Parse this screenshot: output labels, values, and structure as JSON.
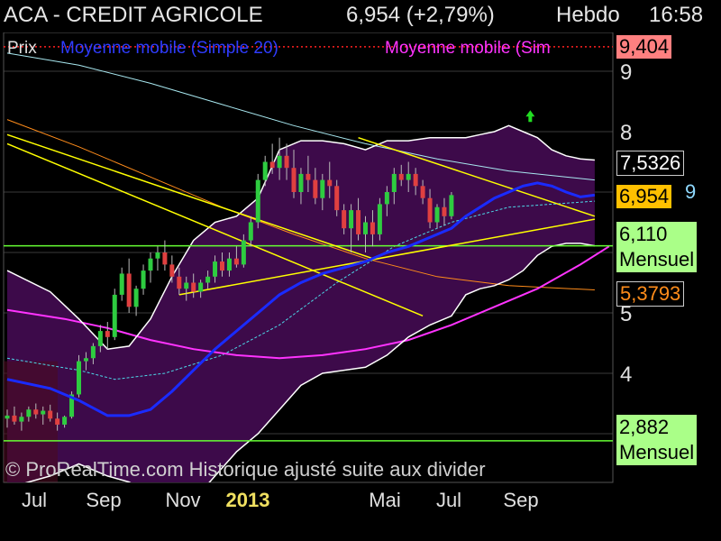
{
  "header": {
    "title": "ACA - CREDIT AGRICOLE",
    "price_change": "6,954 (+2,79%)",
    "period": "Hebdo",
    "time": "16:58"
  },
  "legend": {
    "prix": "Prix",
    "mm20": "Moyenne mobile (Simple 20)",
    "mm2": "Moyenne mobile (Sim"
  },
  "price_boxes": {
    "high": "9,404",
    "upper": "7,5326",
    "current": "6,954",
    "current_tail": "9",
    "support1": "6,110",
    "support1_label": "Mensuel",
    "lower": "5,3793",
    "support2": "2,882",
    "support2_label": "Mensuel"
  },
  "copyright": "© ProRealTime.com Historique ajusté suite aux divider",
  "colors": {
    "background": "#000000",
    "up_candle": "#2ecc40",
    "down_candle": "#e04040",
    "mm20": "#1a2bff",
    "mm_long": "#ff33ff",
    "bollinger_fill": "#3d0a4a",
    "trendline": "#ffff00",
    "support_line": "#66ff33",
    "resistance_dotted": "#ff2020",
    "grid": "#3a3a3a"
  },
  "chart_data": {
    "type": "candlestick",
    "title": "ACA - CREDIT AGRICOLE",
    "period": "Hebdo",
    "yticks": [
      4,
      5,
      8,
      9
    ],
    "xticks": [
      "Jul",
      "Sep",
      "Nov",
      "2013",
      "Mai",
      "Jul",
      "Sep"
    ],
    "ylim": [
      2.5,
      9.6
    ],
    "horizontal_lines": [
      {
        "value": 9.404,
        "style": "dotted",
        "color": "#ff2020"
      },
      {
        "value": 6.11,
        "label": "Mensuel",
        "color": "#66ff33"
      },
      {
        "value": 2.882,
        "label": "Mensuel",
        "color": "#66ff33"
      }
    ],
    "last_price": 6.954,
    "series": [
      {
        "name": "Prix",
        "kind": "candles",
        "ohlc": [
          [
            3.25,
            3.4,
            3.1,
            3.3
          ],
          [
            3.3,
            3.45,
            3.15,
            3.2
          ],
          [
            3.2,
            3.35,
            3.05,
            3.28
          ],
          [
            3.28,
            3.45,
            3.2,
            3.4
          ],
          [
            3.4,
            3.5,
            3.25,
            3.32
          ],
          [
            3.32,
            3.45,
            3.15,
            3.38
          ],
          [
            3.38,
            3.48,
            3.2,
            3.25
          ],
          [
            3.25,
            3.35,
            3.05,
            3.15
          ],
          [
            3.15,
            3.3,
            3.1,
            3.28
          ],
          [
            3.28,
            3.7,
            3.25,
            3.65
          ],
          [
            3.65,
            4.3,
            3.6,
            4.2
          ],
          [
            4.2,
            4.35,
            4.05,
            4.25
          ],
          [
            4.25,
            4.5,
            4.15,
            4.45
          ],
          [
            4.45,
            4.8,
            4.35,
            4.7
          ],
          [
            4.7,
            4.85,
            4.4,
            4.6
          ],
          [
            4.6,
            5.4,
            4.55,
            5.3
          ],
          [
            5.3,
            5.75,
            5.2,
            5.65
          ],
          [
            5.65,
            5.9,
            5.0,
            5.1
          ],
          [
            5.1,
            5.45,
            4.95,
            5.4
          ],
          [
            5.4,
            5.8,
            5.3,
            5.7
          ],
          [
            5.7,
            6.0,
            5.5,
            5.9
          ],
          [
            5.9,
            6.1,
            5.7,
            6.0
          ],
          [
            6.0,
            6.2,
            5.7,
            5.8
          ],
          [
            5.8,
            5.95,
            5.5,
            5.6
          ],
          [
            5.6,
            5.75,
            5.3,
            5.4
          ],
          [
            5.4,
            5.6,
            5.2,
            5.5
          ],
          [
            5.5,
            5.65,
            5.25,
            5.35
          ],
          [
            5.35,
            5.55,
            5.25,
            5.5
          ],
          [
            5.5,
            5.7,
            5.4,
            5.6
          ],
          [
            5.6,
            5.95,
            5.5,
            5.85
          ],
          [
            5.85,
            6.0,
            5.6,
            5.7
          ],
          [
            5.7,
            6.0,
            5.6,
            5.9
          ],
          [
            5.9,
            6.1,
            5.75,
            5.8
          ],
          [
            5.8,
            6.3,
            5.75,
            6.2
          ],
          [
            6.2,
            6.6,
            6.1,
            6.5
          ],
          [
            6.5,
            7.3,
            6.4,
            7.2
          ],
          [
            7.2,
            7.6,
            7.1,
            7.5
          ],
          [
            7.5,
            7.8,
            7.3,
            7.4
          ],
          [
            7.4,
            7.9,
            7.2,
            7.6
          ],
          [
            7.6,
            7.8,
            7.2,
            7.4
          ],
          [
            7.4,
            7.7,
            6.9,
            7.0
          ],
          [
            7.0,
            7.4,
            6.8,
            7.3
          ],
          [
            7.3,
            7.6,
            7.0,
            7.2
          ],
          [
            7.2,
            7.4,
            6.8,
            6.9
          ],
          [
            6.9,
            7.3,
            6.7,
            7.2
          ],
          [
            7.2,
            7.5,
            6.9,
            7.1
          ],
          [
            7.1,
            7.2,
            6.6,
            6.7
          ],
          [
            6.7,
            6.8,
            6.3,
            6.4
          ],
          [
            6.4,
            6.8,
            6.0,
            6.7
          ],
          [
            6.7,
            6.9,
            6.2,
            6.3
          ],
          [
            6.3,
            6.6,
            6.0,
            6.5
          ],
          [
            6.5,
            6.7,
            6.1,
            6.3
          ],
          [
            6.3,
            6.9,
            6.2,
            6.8
          ],
          [
            6.8,
            7.1,
            6.6,
            7.0
          ],
          [
            7.0,
            7.4,
            6.8,
            7.3
          ],
          [
            7.3,
            7.45,
            7.1,
            7.2
          ],
          [
            7.2,
            7.5,
            7.0,
            7.3
          ],
          [
            7.3,
            7.4,
            6.95,
            7.1
          ],
          [
            7.1,
            7.2,
            6.8,
            6.9
          ],
          [
            6.9,
            7.05,
            6.4,
            6.5
          ],
          [
            6.5,
            6.8,
            6.4,
            6.75
          ],
          [
            6.75,
            6.9,
            6.45,
            6.6
          ],
          [
            6.6,
            7.0,
            6.55,
            6.95
          ]
        ]
      },
      {
        "name": "Moyenne mobile (Simple 20)",
        "kind": "line",
        "points": [
          [
            0,
            3.9
          ],
          [
            6,
            3.75
          ],
          [
            10,
            3.55
          ],
          [
            14,
            3.3
          ],
          [
            17,
            3.3
          ],
          [
            20,
            3.4
          ],
          [
            23,
            3.7
          ],
          [
            26,
            4.05
          ],
          [
            29,
            4.4
          ],
          [
            32,
            4.7
          ],
          [
            35,
            5.0
          ],
          [
            38,
            5.3
          ],
          [
            41,
            5.5
          ],
          [
            44,
            5.65
          ],
          [
            47,
            5.75
          ],
          [
            50,
            5.85
          ],
          [
            53,
            6.0
          ],
          [
            56,
            6.1
          ],
          [
            59,
            6.25
          ],
          [
            62,
            6.4
          ],
          [
            64,
            6.6
          ],
          [
            66,
            6.75
          ],
          [
            68,
            6.9
          ],
          [
            70,
            7.0
          ],
          [
            72,
            7.1
          ],
          [
            74,
            7.15
          ],
          [
            76,
            7.1
          ],
          [
            78,
            7.0
          ],
          [
            80,
            6.92
          ],
          [
            82,
            6.95
          ]
        ]
      },
      {
        "name": "Moyenne mobile (Sim",
        "kind": "line",
        "points": [
          [
            0,
            5.05
          ],
          [
            8,
            4.9
          ],
          [
            14,
            4.75
          ],
          [
            20,
            4.55
          ],
          [
            26,
            4.4
          ],
          [
            32,
            4.3
          ],
          [
            38,
            4.25
          ],
          [
            44,
            4.3
          ],
          [
            50,
            4.4
          ],
          [
            56,
            4.55
          ],
          [
            62,
            4.8
          ],
          [
            68,
            5.1
          ],
          [
            74,
            5.4
          ],
          [
            80,
            5.8
          ],
          [
            84,
            6.1
          ]
        ]
      },
      {
        "name": "MM long (cyan)",
        "kind": "line",
        "points": [
          [
            0,
            9.3
          ],
          [
            10,
            9.1
          ],
          [
            20,
            8.8
          ],
          [
            30,
            8.45
          ],
          [
            40,
            8.1
          ],
          [
            50,
            7.8
          ],
          [
            60,
            7.55
          ],
          [
            70,
            7.35
          ],
          [
            82,
            7.2
          ]
        ]
      },
      {
        "name": "MM long (orange)",
        "kind": "line",
        "points": [
          [
            0,
            8.2
          ],
          [
            10,
            7.75
          ],
          [
            20,
            7.25
          ],
          [
            30,
            6.75
          ],
          [
            40,
            6.3
          ],
          [
            50,
            5.9
          ],
          [
            60,
            5.6
          ],
          [
            70,
            5.45
          ],
          [
            82,
            5.38
          ]
        ]
      },
      {
        "name": "MM (cyan pointillé)",
        "kind": "line",
        "points": [
          [
            0,
            4.25
          ],
          [
            10,
            4.05
          ],
          [
            15,
            3.9
          ],
          [
            22,
            4.0
          ],
          [
            30,
            4.3
          ],
          [
            38,
            4.8
          ],
          [
            46,
            5.5
          ],
          [
            54,
            6.1
          ],
          [
            62,
            6.5
          ],
          [
            70,
            6.75
          ],
          [
            82,
            6.85
          ]
        ]
      },
      {
        "name": "Bollinger haute",
        "kind": "line",
        "points": [
          [
            0,
            5.7
          ],
          [
            6,
            5.35
          ],
          [
            10,
            4.9
          ],
          [
            14,
            4.4
          ],
          [
            17,
            4.45
          ],
          [
            20,
            4.9
          ],
          [
            23,
            5.6
          ],
          [
            26,
            6.2
          ],
          [
            29,
            6.5
          ],
          [
            32,
            6.6
          ],
          [
            35,
            6.9
          ],
          [
            38,
            7.7
          ],
          [
            41,
            7.85
          ],
          [
            44,
            7.85
          ],
          [
            47,
            7.8
          ],
          [
            50,
            7.7
          ],
          [
            53,
            7.85
          ],
          [
            56,
            7.85
          ],
          [
            59,
            7.9
          ],
          [
            62,
            7.9
          ],
          [
            64,
            7.9
          ],
          [
            66,
            7.95
          ],
          [
            68,
            8.0
          ],
          [
            70,
            8.1
          ],
          [
            72,
            8.0
          ],
          [
            74,
            7.9
          ],
          [
            76,
            7.7
          ],
          [
            78,
            7.6
          ],
          [
            80,
            7.55
          ],
          [
            82,
            7.53
          ]
        ]
      },
      {
        "name": "Bollinger basse",
        "kind": "line",
        "points": [
          [
            0,
            2.1
          ],
          [
            6,
            2.3
          ],
          [
            10,
            2.5
          ],
          [
            14,
            2.3
          ],
          [
            17,
            2.2
          ],
          [
            20,
            2.0
          ],
          [
            23,
            1.8
          ],
          [
            26,
            1.9
          ],
          [
            29,
            2.3
          ],
          [
            32,
            2.7
          ],
          [
            35,
            3.0
          ],
          [
            38,
            3.4
          ],
          [
            41,
            3.8
          ],
          [
            44,
            4.0
          ],
          [
            47,
            4.05
          ],
          [
            50,
            4.1
          ],
          [
            53,
            4.3
          ],
          [
            56,
            4.6
          ],
          [
            59,
            4.8
          ],
          [
            62,
            4.95
          ],
          [
            64,
            5.3
          ],
          [
            66,
            5.4
          ],
          [
            68,
            5.45
          ],
          [
            70,
            5.55
          ],
          [
            72,
            5.7
          ],
          [
            74,
            5.95
          ],
          [
            76,
            6.1
          ],
          [
            78,
            6.15
          ],
          [
            80,
            6.15
          ],
          [
            82,
            6.11
          ]
        ]
      }
    ],
    "trendlines": [
      {
        "from": [
          0,
          7.95
        ],
        "to": [
          51,
          5.9
        ]
      },
      {
        "from": [
          0,
          7.8
        ],
        "to": [
          58,
          4.95
        ]
      },
      {
        "from": [
          24,
          5.3
        ],
        "to": [
          82,
          6.55
        ]
      },
      {
        "from": [
          49,
          7.9
        ],
        "to": [
          82,
          6.6
        ]
      }
    ],
    "arrow_up": {
      "x": 73,
      "y": 8.25
    }
  }
}
